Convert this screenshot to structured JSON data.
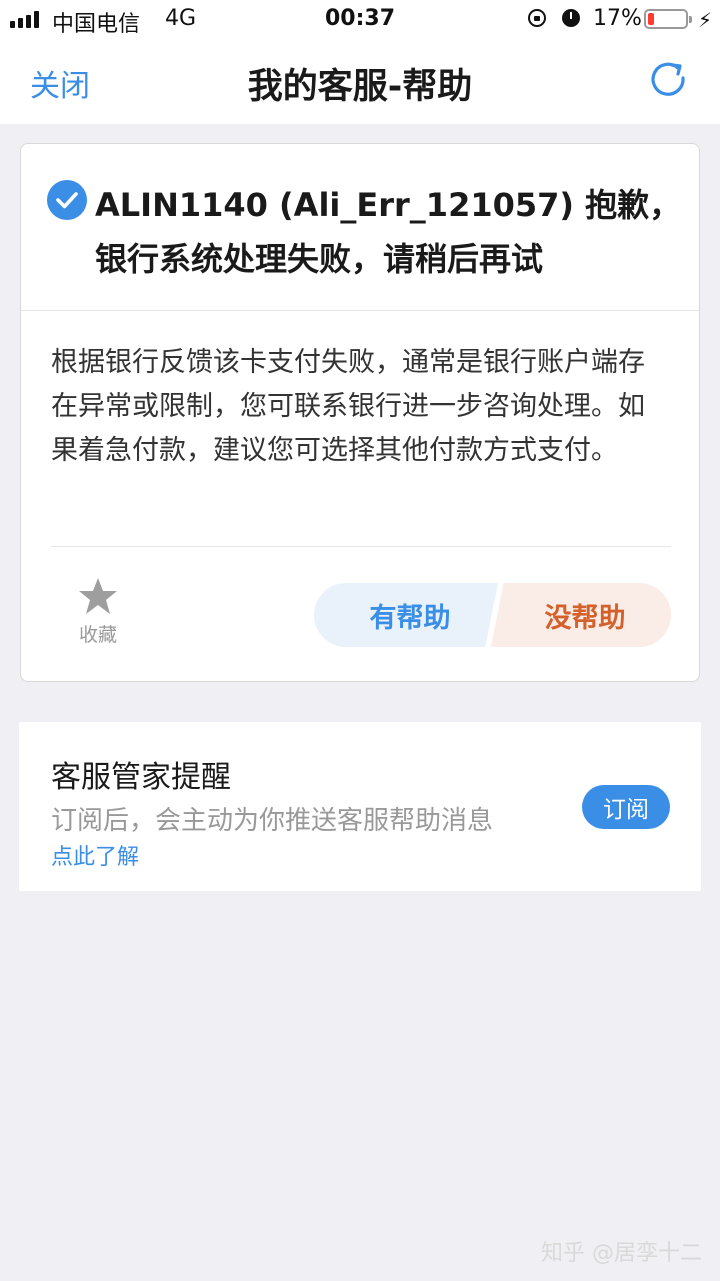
{
  "status_bar": {
    "carrier": "中国电信",
    "network": "4G",
    "time": "00:37",
    "battery_percent": "17%",
    "battery_level": 0.17,
    "icons": [
      "signal-icon",
      "rotation-lock-icon",
      "alarm-icon",
      "battery-icon",
      "charging-bolt-icon"
    ]
  },
  "nav": {
    "close_label": "关闭",
    "title": "我的客服-帮助",
    "refresh_icon": "refresh-icon"
  },
  "card": {
    "title": "ALIN1140 (Ali_Err_121057) 抱歉，银行系统处理失败，请稍后再试",
    "body": "根据银行反馈该卡支付失败，通常是银行账户端存在异常或限制，您可联系银行进一步咨询处理。如果着急付款，建议您可选择其他付款方式支付。",
    "favorite_label": "收藏",
    "helpful_label": "有帮助",
    "unhelpful_label": "没帮助"
  },
  "reminder": {
    "title": "客服管家提醒",
    "description": "订阅后，会主动为你推送客服帮助消息",
    "link": "点此了解",
    "subscribe_label": "订阅"
  },
  "watermark": "知乎 @居孪十二",
  "colors": {
    "accent": "#3a8ee6",
    "unhelpful": "#d4602b",
    "background": "#efeff4"
  }
}
